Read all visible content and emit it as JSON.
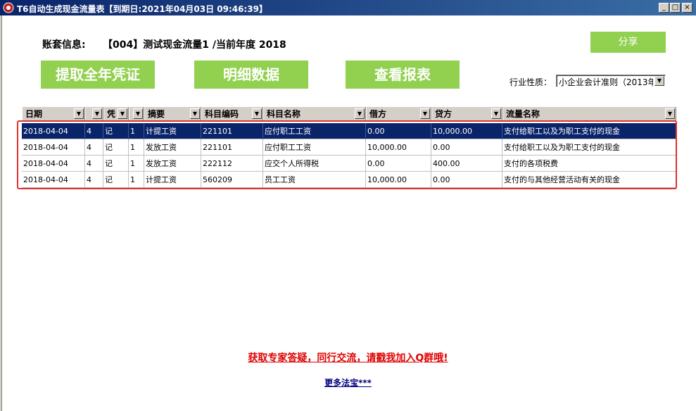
{
  "window": {
    "title": "T6自动生成现金流量表【到期日:2021年04月03日  09:46:39】",
    "minimize_icon": "minimize-icon",
    "maximize_icon": "maximize-icon",
    "close_icon": "close-icon"
  },
  "account": {
    "label": "账套信息:",
    "value": "【004】测试现金流量1 /当前年度 2018"
  },
  "buttons": {
    "share": "分享",
    "extract": "提取全年凭证",
    "detail": "明细数据",
    "report": "查看报表"
  },
  "industry": {
    "label": "行业性质：",
    "selected": "小企业会计准则（2013年"
  },
  "grid": {
    "columns": [
      "日期",
      "",
      "凭",
      "",
      "摘要",
      "科目编码",
      "科目名称",
      "借方",
      "贷方",
      "流量名称"
    ],
    "rows": [
      {
        "date": "2018-04-04",
        "period": "4",
        "voucher_type": "记",
        "voucher_no": "1",
        "summary": "计提工资",
        "code": "221101",
        "subject": "应付职工工资",
        "debit": "0.00",
        "credit": "10,000.00",
        "flow": "支付给职工以及为职工支付的现金"
      },
      {
        "date": "2018-04-04",
        "period": "4",
        "voucher_type": "记",
        "voucher_no": "1",
        "summary": "发放工资",
        "code": "221101",
        "subject": "应付职工工资",
        "debit": "10,000.00",
        "credit": "0.00",
        "flow": "支付给职工以及为职工支付的现金"
      },
      {
        "date": "2018-04-04",
        "period": "4",
        "voucher_type": "记",
        "voucher_no": "1",
        "summary": "发放工资",
        "code": "222112",
        "subject": "应交个人所得税",
        "debit": "0.00",
        "credit": "400.00",
        "flow": "支付的各项税费"
      },
      {
        "date": "2018-04-04",
        "period": "4",
        "voucher_type": "记",
        "voucher_no": "1",
        "summary": "计提工资",
        "code": "560209",
        "subject": "员工工资",
        "debit": "10,000.00",
        "credit": "0.00",
        "flow": "支付的与其他经营活动有关的现金"
      }
    ]
  },
  "footer": {
    "promo": "获取专家答疑，同行交流，请戳我加入Q群哦!",
    "more": "更多法宝***"
  },
  "colors": {
    "accent_green": "#92d050",
    "selection": "#0a246a",
    "promo_red": "#e00000",
    "highlight_border": "#e03030"
  }
}
